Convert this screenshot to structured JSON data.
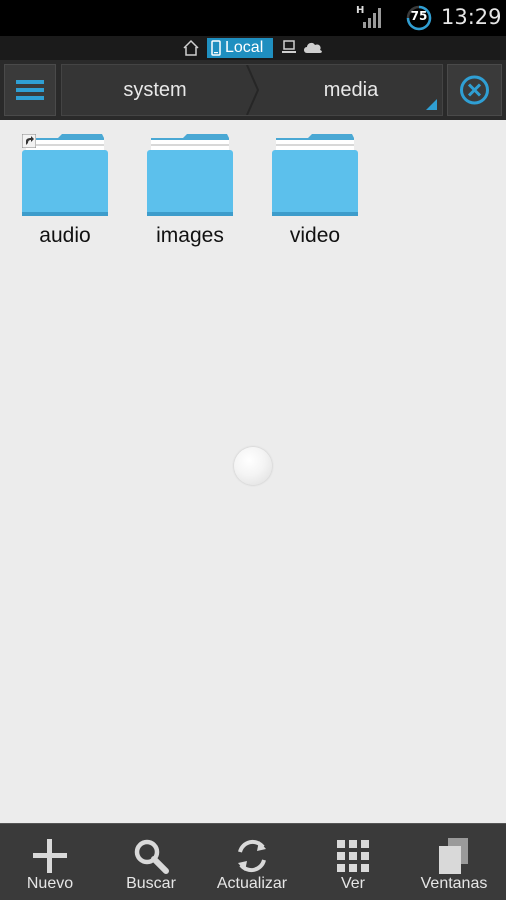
{
  "status_bar": {
    "network_type": "H",
    "battery_level": "75",
    "time": "13:29"
  },
  "location_bar": {
    "active_location": "Local",
    "icons": [
      "home-icon",
      "phone-icon",
      "network-icon",
      "cloud-icon"
    ]
  },
  "path_bar": {
    "crumbs": [
      {
        "label": "system"
      },
      {
        "label": "media"
      }
    ]
  },
  "folders": [
    {
      "name": "audio",
      "shortcut": true
    },
    {
      "name": "images",
      "shortcut": false
    },
    {
      "name": "video",
      "shortcut": false
    }
  ],
  "toolbar": {
    "buttons": [
      {
        "label": "Nuevo",
        "icon": "plus-icon"
      },
      {
        "label": "Buscar",
        "icon": "search-icon"
      },
      {
        "label": "Actualizar",
        "icon": "refresh-icon"
      },
      {
        "label": "Ver",
        "icon": "grid-icon"
      },
      {
        "label": "Ventanas",
        "icon": "windows-icon"
      }
    ]
  },
  "colors": {
    "accent": "#2f9fd4",
    "folder": "#5cc0ec",
    "toolbar_bg": "#3a3a3a",
    "content_bg": "#ececec"
  }
}
